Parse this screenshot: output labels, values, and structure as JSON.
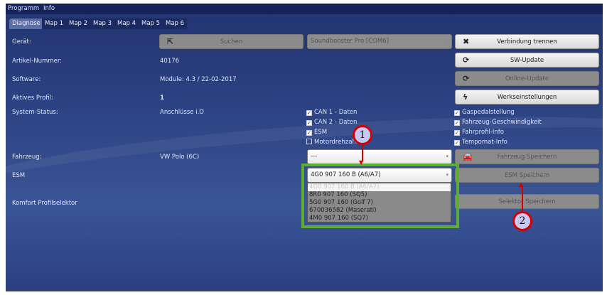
{
  "menu": [
    "Programm",
    "Info"
  ],
  "tabs": [
    "Diagnose",
    "Map 1",
    "Map 2",
    "Map 3",
    "Map 4",
    "Map 5",
    "Map 6"
  ],
  "labels": {
    "geraet": "Gerät:",
    "artikel": "Artikel-Nummer:",
    "software": "Software:",
    "profil": "Aktives Profil:",
    "status": "System-Status:",
    "fahrzeug": "Fahrzeug:",
    "esm": "ESM",
    "komfort": "Komfort Profilselektor"
  },
  "values": {
    "artikel": "40176",
    "software": "Module: 4.3 / 22-02-2017",
    "profil": "1",
    "status": "Anschlüsse i.O",
    "fahrzeug": "VW Polo (6C)"
  },
  "buttons": {
    "suchen": "Suchen",
    "verbindung": "Verbindung trennen",
    "sw_update": "SW-Update",
    "online_update": "Online-Update",
    "werk": "Werkseinstellungen",
    "fahrzeug_speichern": "Fahrzeug Speichern",
    "esm_speichern": "ESM Speichern",
    "selektor_speichern": "Selektor Speichern"
  },
  "selects": {
    "device": "Soundbooster Pro [COM6]",
    "fahrzeug": "---",
    "esm": "4G0 907 160 B (A6/A7)"
  },
  "esm_options": [
    "4G0 907 160 B (A6/A7)",
    "8R0 907 160 (SQ5)",
    "5G0 907 160 (Golf 7)",
    "670036582 (Maserati)",
    "4M0 907 160 (SQ7)"
  ],
  "checks_left": [
    {
      "label": "CAN 1 - Daten",
      "checked": true
    },
    {
      "label": "CAN 2 - Daten",
      "checked": true
    },
    {
      "label": "ESM",
      "checked": true
    },
    {
      "label": "Motordrehzahl",
      "checked": false
    }
  ],
  "checks_right": [
    {
      "label": "Gaspedalstellung",
      "checked": true
    },
    {
      "label": "Fahrzeug-Geschwindigkeit",
      "checked": true
    },
    {
      "label": "Fahrprofil-Info",
      "checked": true
    },
    {
      "label": "Tempomat-Info",
      "checked": true
    }
  ],
  "annotations": [
    "1",
    "2"
  ]
}
